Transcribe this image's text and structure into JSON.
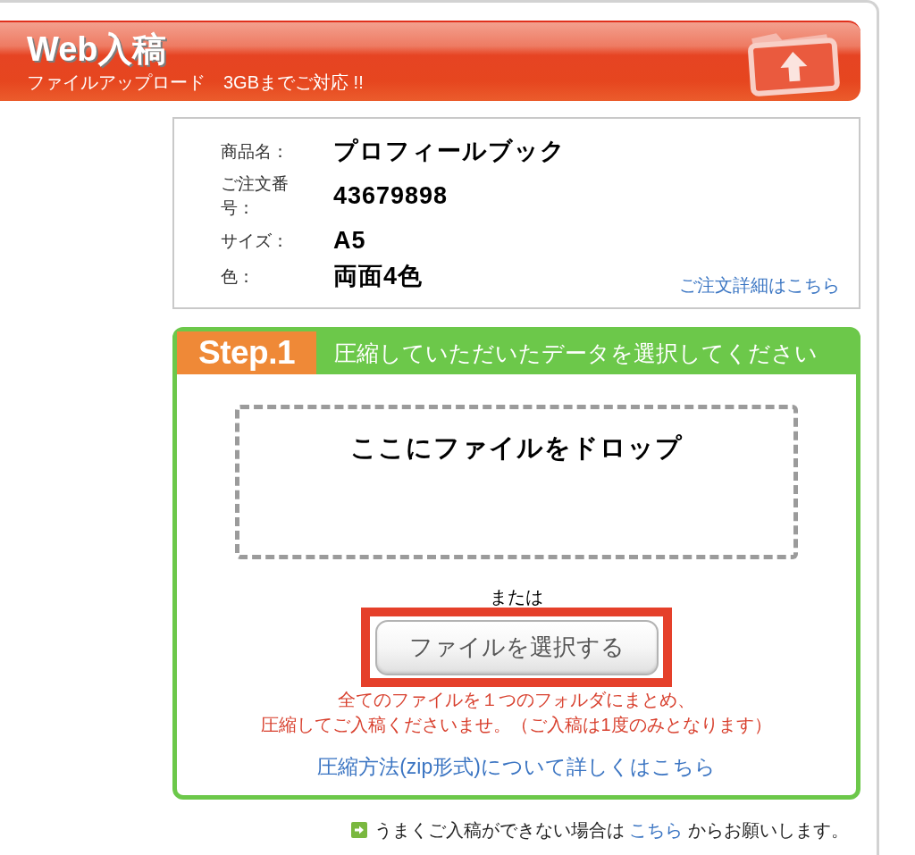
{
  "header": {
    "title": "Web入稿",
    "subtitle": "ファイルアップロード　3GBまでご対応 !!"
  },
  "order_info": {
    "fields": [
      {
        "label": "商品名：",
        "value": "プロフィールブック"
      },
      {
        "label": "ご注文番号：",
        "value": "43679898"
      },
      {
        "label": "サイズ：",
        "value": "A5"
      },
      {
        "label": "色：",
        "value": "両面4色"
      }
    ],
    "details_link": "ご注文詳細はこちら"
  },
  "step": {
    "badge": "Step.1",
    "title": "圧縮していただいたデータを選択してください",
    "dropzone_label": "ここにファイルをドロップ",
    "separator": "または",
    "button": {
      "label": "ファイルを選択する",
      "highlighted": true
    },
    "note_lines": [
      "全てのファイルを１つのフォルダにまとめ、",
      "圧縮してご入稿くださいませ。（ご入稿は1度のみとなります）"
    ],
    "help_link": "圧縮方法(zip形式)について詳しくはこちら"
  },
  "footer": {
    "text_before": "うまくご入稿ができない場合は",
    "link": "こちら",
    "text_after": "からお願いします。"
  }
}
